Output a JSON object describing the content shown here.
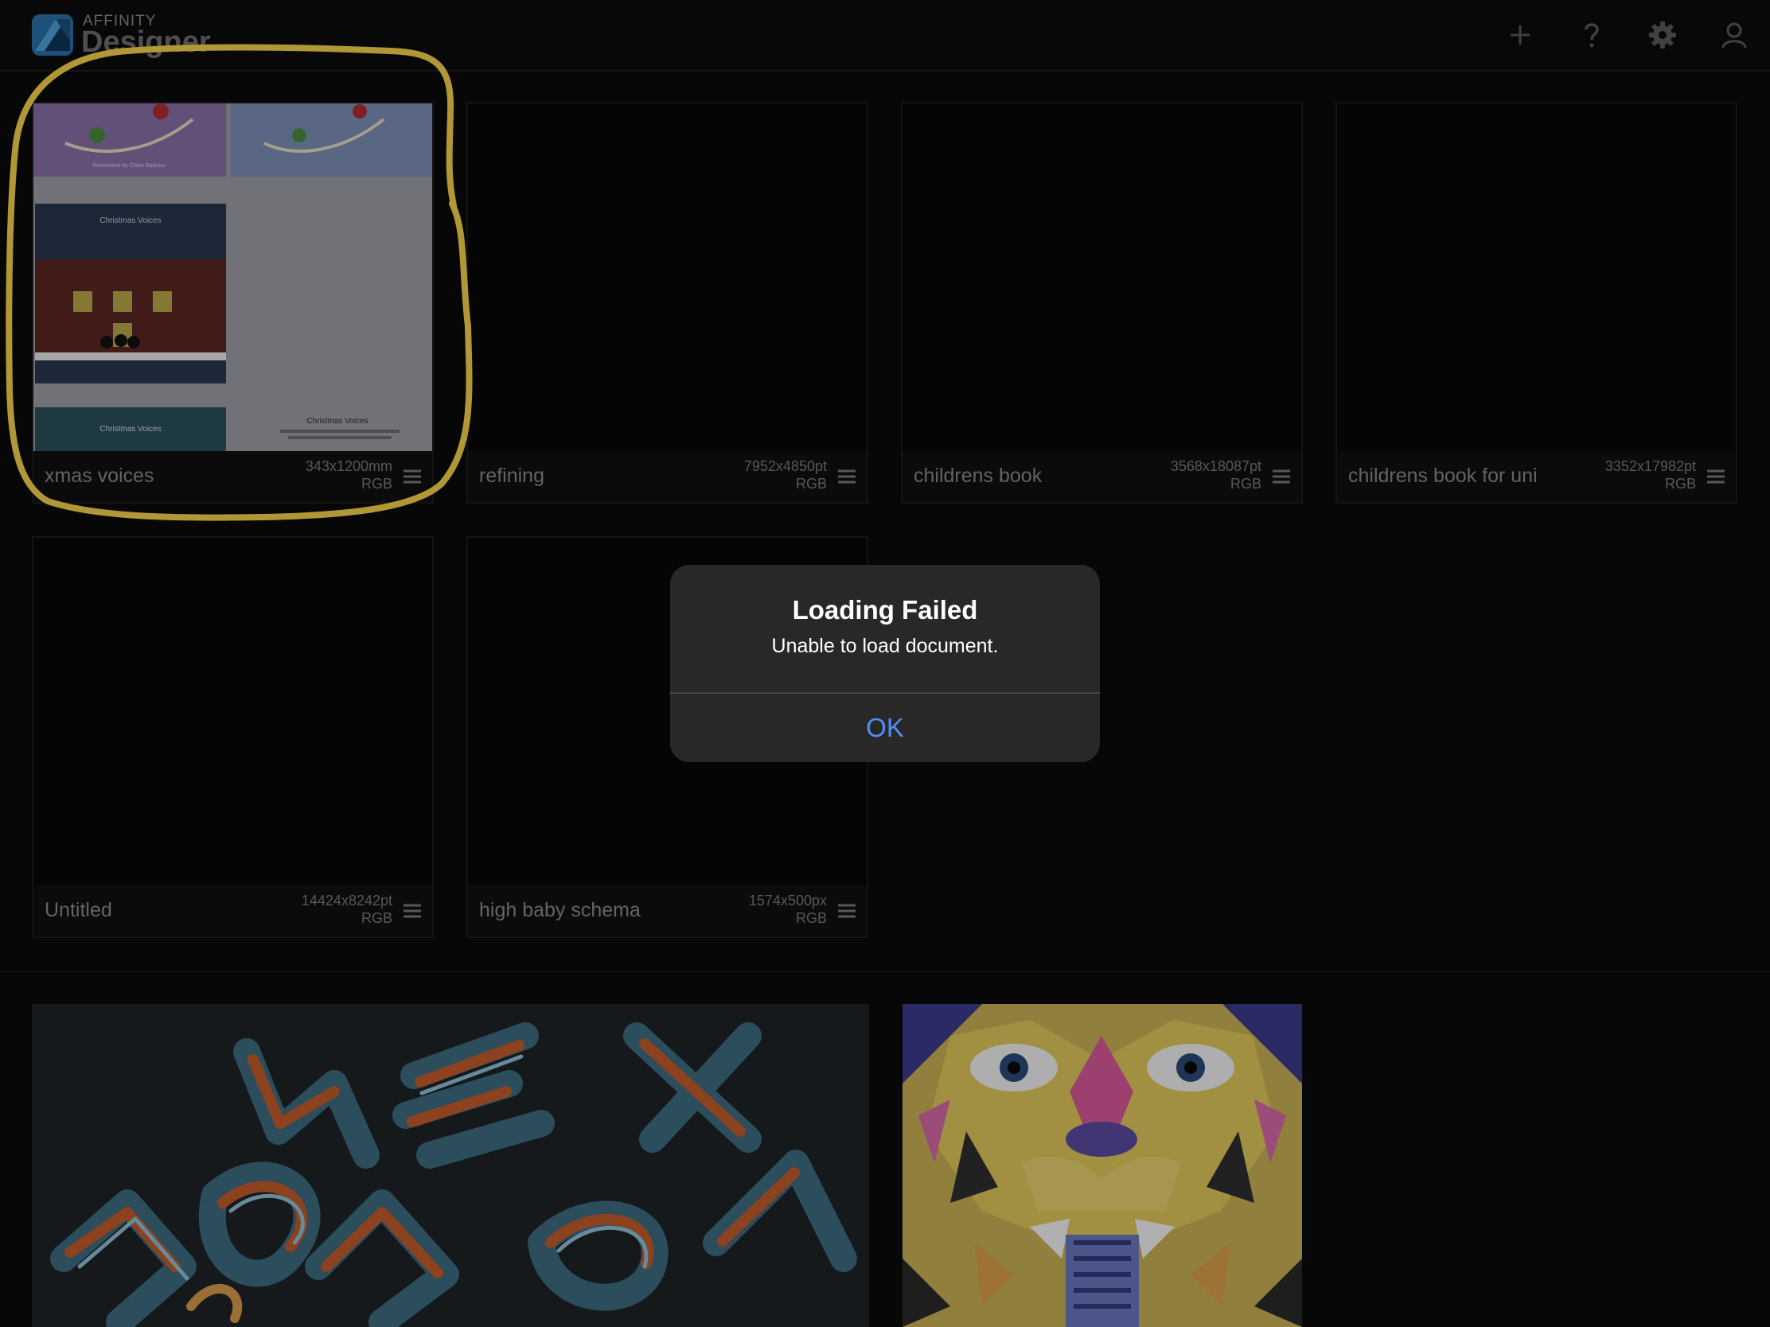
{
  "app": {
    "brand_small": "AFFINITY",
    "brand_big": "Designer"
  },
  "header_icons": [
    "add-icon",
    "help-icon",
    "settings-gear-icon",
    "account-icon"
  ],
  "documents": [
    {
      "name": "xmas voices",
      "size": "343x1200mm",
      "mode": "RGB"
    },
    {
      "name": "refining",
      "size": "7952x4850pt",
      "mode": "RGB"
    },
    {
      "name": "childrens book",
      "size": "3568x18087pt",
      "mode": "RGB"
    },
    {
      "name": "childrens book for uni",
      "size": "3352x17982pt",
      "mode": "RGB"
    },
    {
      "name": "Untitled",
      "size": "14424x8242pt",
      "mode": "RGB"
    },
    {
      "name": "high baby schema",
      "size": "1574x500px",
      "mode": "RGB"
    }
  ],
  "dialog": {
    "title": "Loading Failed",
    "message": "Unable to load document.",
    "ok_label": "OK"
  },
  "thumb_text": {
    "credit": "Illustrations by Claire Barbour",
    "panel_title": "Christmas Voices",
    "panel_sub": "Reflections, carols poems, and prayers for the festive season reflections, carols poems, and"
  },
  "colors": {
    "accent": "#4f8ff7",
    "highlight": "#f5d24a",
    "background": "#0a0a0a"
  }
}
